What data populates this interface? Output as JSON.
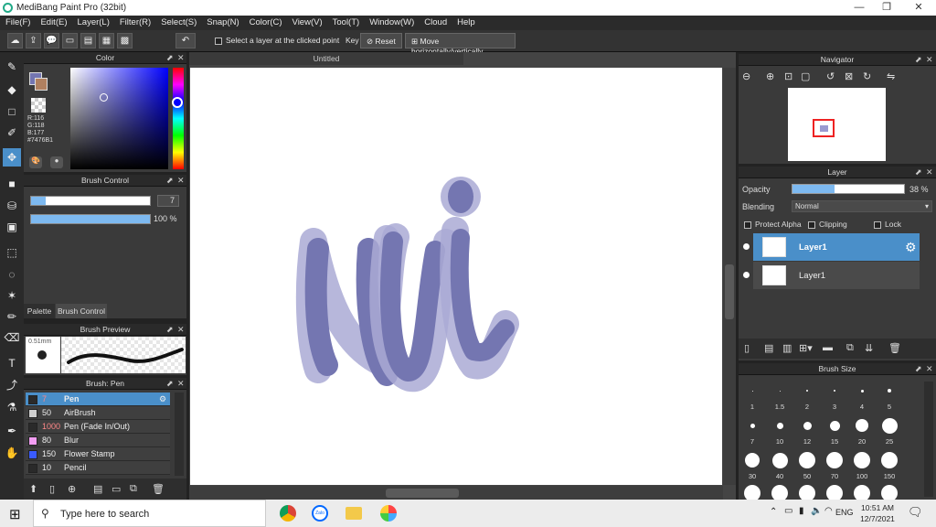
{
  "window": {
    "title": "MediBang Paint Pro (32bit)"
  },
  "menu": [
    "File(F)",
    "Edit(E)",
    "Layer(L)",
    "Filter(R)",
    "Select(S)",
    "Snap(N)",
    "Color(C)",
    "View(V)",
    "Tool(T)",
    "Window(W)",
    "Cloud",
    "Help"
  ],
  "toolbar": {
    "select_layer_label": "Select a layer at the clicked point",
    "key_label": "Key",
    "reset_label": "Reset",
    "move_label": "Move horizontally/vertically"
  },
  "color_panel": {
    "title": "Color",
    "r": "R:116",
    "g": "G:118",
    "b": "B:177",
    "hex": "#7476B1",
    "current_color": "#7476b1"
  },
  "brush_control": {
    "title": "Brush Control",
    "size_value": "7",
    "opacity_value": "100 %",
    "size_fraction": 0.12,
    "opacity_fraction": 1.0
  },
  "tabs": {
    "palette": "Palette",
    "brush_control": "Brush Control"
  },
  "brush_preview": {
    "title": "Brush Preview",
    "size_label": "0.51mm"
  },
  "brush_list": {
    "title": "Brush: Pen",
    "items": [
      {
        "size": "7",
        "name": "Pen",
        "color": "#2a2a2a",
        "selected": true
      },
      {
        "size": "50",
        "name": "AirBrush",
        "color": "#cfcfcf"
      },
      {
        "size": "1000",
        "name": "Pen (Fade In/Out)",
        "color": "#2a2a2a"
      },
      {
        "size": "80",
        "name": "Blur",
        "color": "#f29df2"
      },
      {
        "size": "150",
        "name": "Flower Stamp",
        "color": "#3a5bff"
      },
      {
        "size": "10",
        "name": "Pencil",
        "color": "#2a2a2a"
      }
    ]
  },
  "document": {
    "tab_title": "Untitled"
  },
  "navigator": {
    "title": "Navigator"
  },
  "layer_panel": {
    "title": "Layer",
    "opacity_label": "Opacity",
    "opacity_value": "38 %",
    "opacity_fraction": 0.38,
    "blending_label": "Blending",
    "blending_value": "Normal",
    "protect_alpha": "Protect Alpha",
    "clipping": "Clipping",
    "lock": "Lock",
    "layers": [
      {
        "name": "Layer1",
        "selected": true
      },
      {
        "name": "Layer1",
        "selected": false
      }
    ]
  },
  "brush_size": {
    "title": "Brush Size",
    "row1": [
      "1",
      "1.5",
      "2",
      "3",
      "4",
      "5"
    ],
    "row2": [
      "7",
      "10",
      "12",
      "15",
      "20",
      "25"
    ],
    "row3": [
      "30",
      "40",
      "50",
      "70",
      "100",
      "150"
    ]
  },
  "taskbar": {
    "search_placeholder": "Type here to search",
    "language": "ENG",
    "time": "10:51 AM",
    "date": "12/7/2021"
  }
}
